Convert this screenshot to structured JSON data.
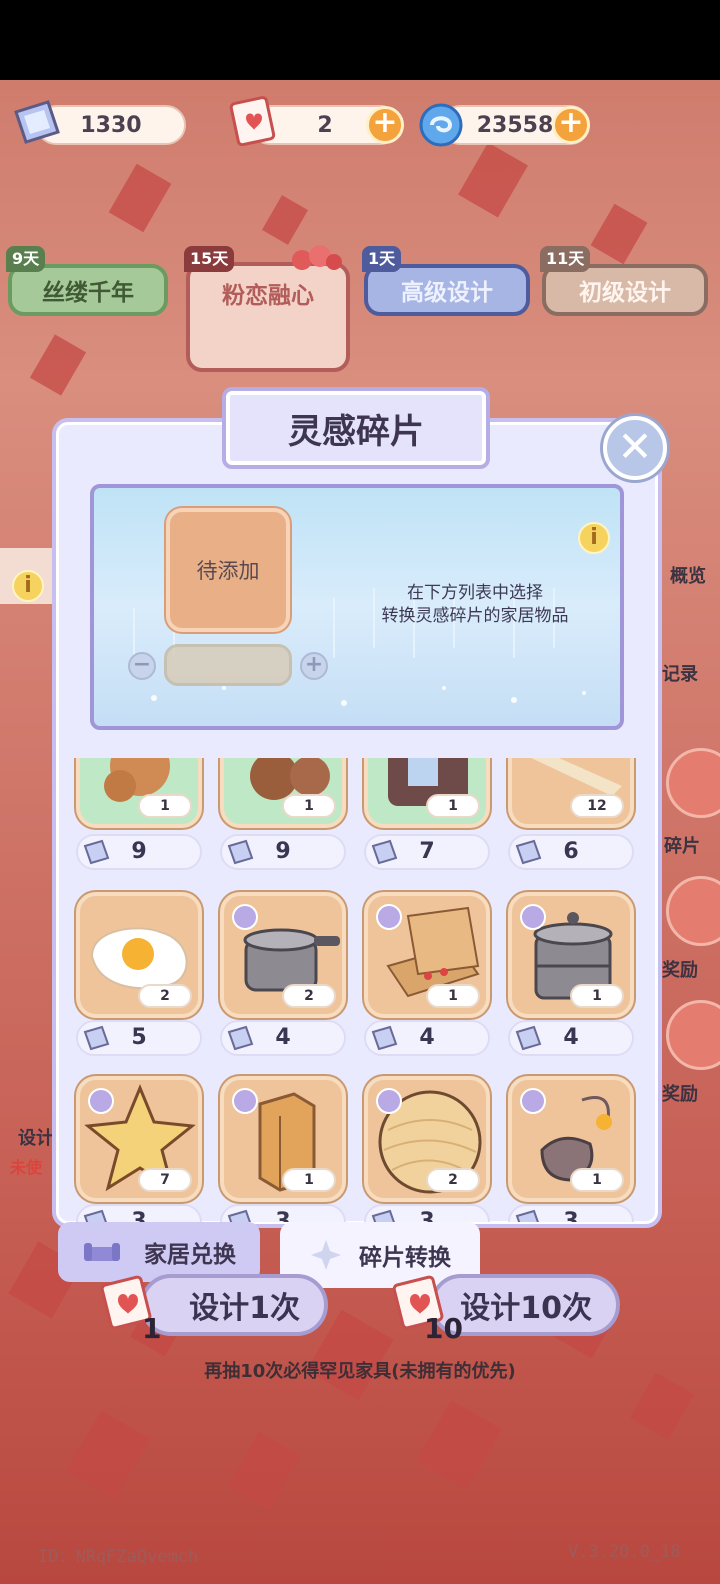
{
  "currency": {
    "fragments": "1330",
    "tickets": "2",
    "gems": "23558"
  },
  "tabs": [
    {
      "days": "9天",
      "label": "丝缕千年"
    },
    {
      "days": "15天",
      "label": "粉恋融心"
    },
    {
      "days": "1天",
      "label": "高级设计"
    },
    {
      "days": "11天",
      "label": "初级设计"
    }
  ],
  "side": {
    "overview": "概览",
    "records": "记录",
    "fragments": "碎片",
    "reward1": "奖励",
    "reward2": "奖励",
    "design_left": "设计",
    "unused_left": "未使"
  },
  "modal": {
    "title": "灵感碎片",
    "slot_label": "待添加",
    "hint_line1": "在下方列表中选择",
    "hint_line2": "转换灵感碎片的家居物品"
  },
  "items": [
    {
      "name": "item-1",
      "owned": "1",
      "cost": "9"
    },
    {
      "name": "item-2",
      "owned": "1",
      "cost": "9"
    },
    {
      "name": "item-3",
      "owned": "1",
      "cost": "7"
    },
    {
      "name": "item-4",
      "owned": "12",
      "cost": "6"
    },
    {
      "name": "fried-egg",
      "owned": "2",
      "cost": "5"
    },
    {
      "name": "pressure-cooker",
      "owned": "2",
      "cost": "4"
    },
    {
      "name": "pizza-box",
      "owned": "1",
      "cost": "4"
    },
    {
      "name": "steamer-pot",
      "owned": "1",
      "cost": "4"
    },
    {
      "name": "star-lamp",
      "owned": "7",
      "cost": "3"
    },
    {
      "name": "wood-block",
      "owned": "1",
      "cost": "3"
    },
    {
      "name": "yarn-ball",
      "owned": "2",
      "cost": "3"
    },
    {
      "name": "hanging-ornament",
      "owned": "1",
      "cost": "3"
    }
  ],
  "bottom_tabs": {
    "exchange": "家居兑换",
    "convert": "碎片转换"
  },
  "draw": {
    "once_label": "设计1次",
    "once_count": "1",
    "ten_label": "设计10次",
    "ten_count": "10",
    "notice": "再抽10次必得罕见家具(未拥有的优先)"
  },
  "footer": {
    "id": "ID：NRqFZaQvemch",
    "version": "V.3.20.0_18"
  },
  "colors": {
    "accent": "#f4a23b",
    "modal_bg": "#eaeaff",
    "card_bg": "#efc49b",
    "background": "#cf7c6d"
  }
}
